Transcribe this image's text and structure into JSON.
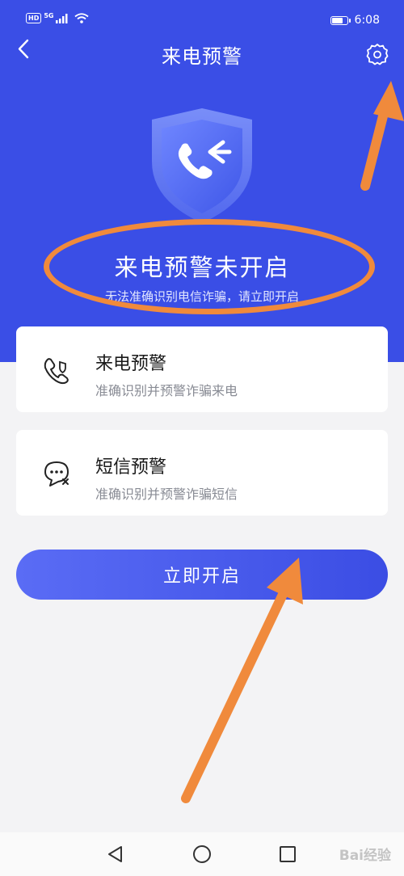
{
  "status_bar": {
    "left_badge": "HD",
    "network": "5G",
    "time": "6:08",
    "battery_level": 0.8
  },
  "header": {
    "title": "来电预警",
    "back_icon": "chevron-left-icon",
    "settings_icon": "gear-icon"
  },
  "hero": {
    "icon": "shield-phone-icon",
    "status_title": "来电预警未开启",
    "status_subtitle": "无法准确识别电信诈骗，请立即开启"
  },
  "features": [
    {
      "title": "来电预警",
      "desc": "准确识别并预警诈骗来电",
      "icon": "phone-shield-icon"
    },
    {
      "title": "短信预警",
      "desc": "准确识别并预警诈骗短信",
      "icon": "message-warning-icon"
    }
  ],
  "actions": {
    "enable_label": "立即开启"
  },
  "bottom_nav": {
    "back_icon": "triangle-back-icon",
    "home_icon": "circle-home-icon",
    "recents_icon": "square-recents-icon"
  },
  "watermark": "Bai经验",
  "colors": {
    "primary": "#3a4ee6",
    "annotation": "#f08a3c",
    "background": "#f3f3f5"
  }
}
